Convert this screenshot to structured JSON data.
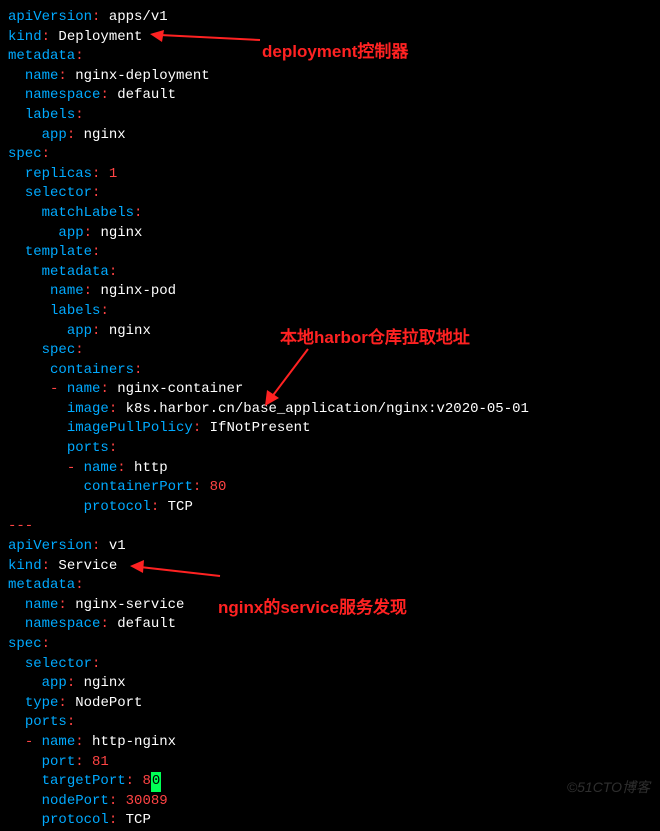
{
  "watermark": "©51CTO博客",
  "annotations": {
    "a1": "deployment控制器",
    "a2": "本地harbor仓库拉取地址",
    "a3": "nginx的service服务发现"
  },
  "lines": {
    "l01_k": "apiVersion",
    "l01_v": "apps/v1",
    "l02_k": "kind",
    "l02_v": "Deployment",
    "l03_k": "metadata",
    "l04_k": "name",
    "l04_v": "nginx-deployment",
    "l05_k": "namespace",
    "l05_v": "default",
    "l06_k": "labels",
    "l07_k": "app",
    "l07_v": "nginx",
    "l08_k": "spec",
    "l09_k": "replicas",
    "l09_v": "1",
    "l10_k": "selector",
    "l11_k": "matchLabels",
    "l12_k": "app",
    "l12_v": "nginx",
    "l13_k": "template",
    "l14_k": "metadata",
    "l15_k": "name",
    "l15_v": "nginx-pod",
    "l16_k": "labels",
    "l17_k": "app",
    "l17_v": "nginx",
    "l18_k": "spec",
    "l19_k": "containers",
    "l20_dash": "- ",
    "l20_k": "name",
    "l20_v": "nginx-container",
    "l21_k": "image",
    "l21_v": "k8s.harbor.cn/base_application/nginx:v2020-05-01",
    "l22_k": "imagePullPolicy",
    "l22_v": "IfNotPresent",
    "l23_k": "ports",
    "l24_dash": "- ",
    "l24_k": "name",
    "l24_v": "http",
    "l25_k": "containerPort",
    "l25_v": "80",
    "l26_k": "protocol",
    "l26_v": "TCP",
    "sep": "---",
    "l27_k": "apiVersion",
    "l27_v": "v1",
    "l28_k": "kind",
    "l28_v": "Service",
    "l29_k": "metadata",
    "l30_k": "name",
    "l30_v": "nginx-service",
    "l31_k": "namespace",
    "l31_v": "default",
    "l32_k": "spec",
    "l33_k": "selector",
    "l34_k": "app",
    "l34_v": "nginx",
    "l35_k": "type",
    "l35_v": "NodePort",
    "l36_k": "ports",
    "l37_dash": "- ",
    "l37_k": "name",
    "l37_v": "http-nginx",
    "l38_k": "port",
    "l38_v": "81",
    "l39_k": "targetPort",
    "l39_v1": "8",
    "l39_v2": "0",
    "l40_k": "nodePort",
    "l40_v": "30089",
    "l41_k": "protocol",
    "l41_v": "TCP"
  }
}
